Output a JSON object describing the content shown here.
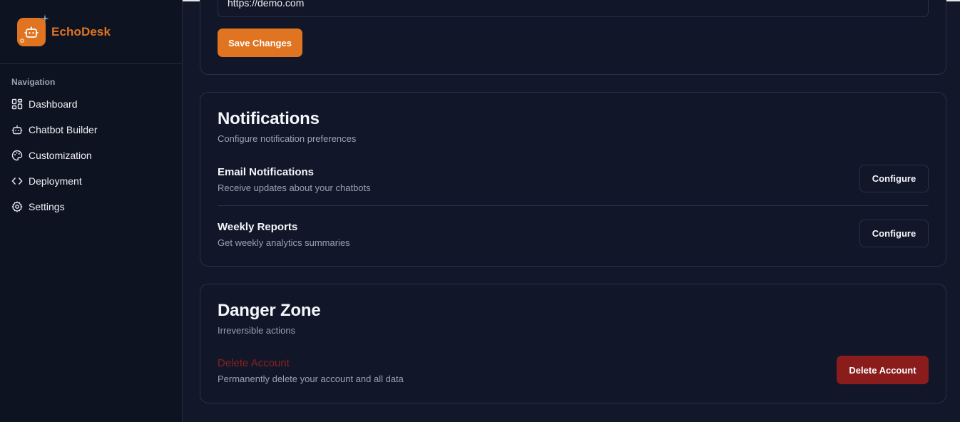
{
  "brand": {
    "name": "EchoDesk",
    "logo_icon": "bot-icon",
    "accent": "#e07420"
  },
  "sidebar": {
    "section_title": "Navigation",
    "items": [
      {
        "label": "Dashboard",
        "icon": "dashboard-icon"
      },
      {
        "label": "Chatbot Builder",
        "icon": "bot-icon"
      },
      {
        "label": "Customization",
        "icon": "palette-icon"
      },
      {
        "label": "Deployment",
        "icon": "code-icon"
      },
      {
        "label": "Settings",
        "icon": "gear-icon"
      }
    ]
  },
  "profile": {
    "website_value": "https://demo.com",
    "save_label": "Save Changes"
  },
  "notifications": {
    "title": "Notifications",
    "subtitle": "Configure notification preferences",
    "rows": [
      {
        "title": "Email Notifications",
        "desc": "Receive updates about your chatbots",
        "button": "Configure"
      },
      {
        "title": "Weekly Reports",
        "desc": "Get weekly analytics summaries",
        "button": "Configure"
      }
    ]
  },
  "danger": {
    "title": "Danger Zone",
    "subtitle": "Irreversible actions",
    "row_title": "Delete Account",
    "row_desc": "Permanently delete your account and all data",
    "button": "Delete Account",
    "color": "#8b1c1c"
  }
}
